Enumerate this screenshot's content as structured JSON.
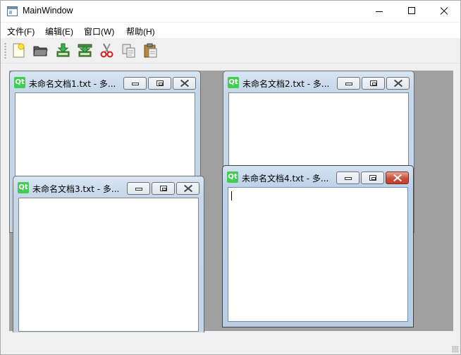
{
  "window": {
    "title": "MainWindow",
    "controls": {
      "minimize": "minimize",
      "maximize": "maximize",
      "close": "close"
    }
  },
  "menu": {
    "items": [
      {
        "label": "文件(F)"
      },
      {
        "label": "编辑(E)"
      },
      {
        "label": "窗口(W)"
      },
      {
        "label": "帮助(H)"
      }
    ]
  },
  "toolbar": {
    "tools": [
      {
        "icon": "new-file-icon"
      },
      {
        "icon": "open-folder-icon"
      },
      {
        "icon": "save-icon"
      },
      {
        "icon": "save-as-icon"
      },
      {
        "icon": "cut-icon"
      },
      {
        "icon": "copy-icon"
      },
      {
        "icon": "paste-icon"
      }
    ]
  },
  "subwindows": [
    {
      "title": "未命名文档1.txt - 多...",
      "icon_text": "Qt",
      "active": false
    },
    {
      "title": "未命名文档2.txt - 多...",
      "icon_text": "Qt",
      "active": false
    },
    {
      "title": "未命名文档3.txt - 多...",
      "icon_text": "Qt",
      "active": false
    },
    {
      "title": "未命名文档4.txt - 多...",
      "icon_text": "Qt",
      "active": true
    }
  ],
  "colors": {
    "mdi_background": "#a0a0a0",
    "qt_green": "#41cd52",
    "active_close": "#c74f3a"
  }
}
